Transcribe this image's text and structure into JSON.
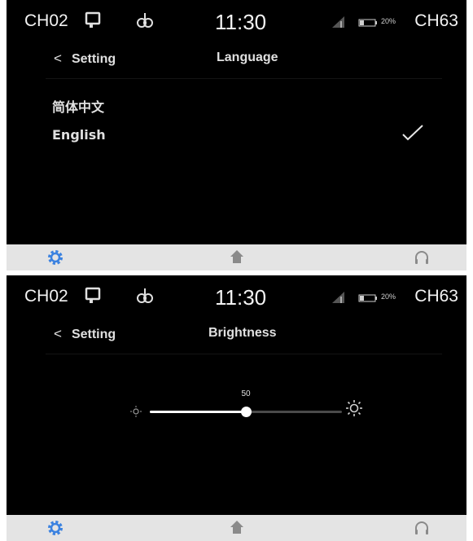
{
  "screens": [
    {
      "status": {
        "left_channel": "CH02",
        "time": "11:30",
        "battery": "20%",
        "right_channel": "CH63"
      },
      "header": {
        "back_label": "Setting",
        "title": "Language"
      },
      "languages": [
        {
          "label": "简体中文",
          "selected": false
        },
        {
          "label": "English",
          "selected": true
        }
      ],
      "nav": [
        "gear-icon",
        "home-icon",
        "headphones-icon"
      ],
      "active_nav": "gear-icon"
    },
    {
      "status": {
        "left_channel": "CH02",
        "time": "11:30",
        "battery": "20%",
        "right_channel": "CH63"
      },
      "header": {
        "back_label": "Setting",
        "title": "Brightness"
      },
      "brightness": {
        "value": 50,
        "value_text": "50",
        "min": 0,
        "max": 100
      },
      "nav": [
        "gear-icon",
        "home-icon",
        "headphones-icon"
      ],
      "active_nav": "gear-icon"
    }
  ],
  "colors": {
    "screen_bg": "#000000",
    "nav_bg": "#e4e4e4",
    "accent": "#3b82e0",
    "nav_icon": "#8a8a8a"
  }
}
